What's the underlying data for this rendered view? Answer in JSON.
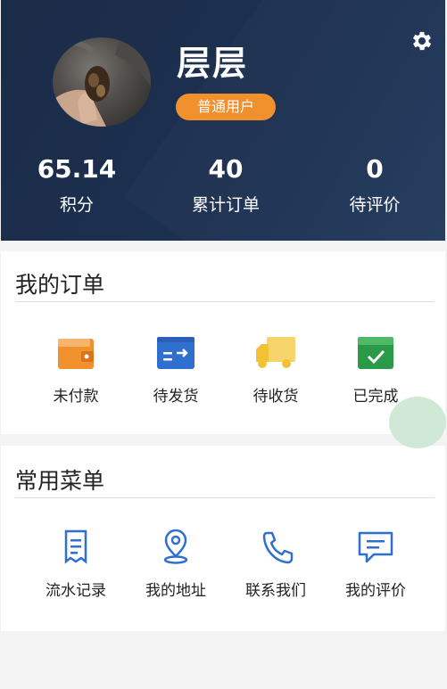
{
  "profile": {
    "name": "层层",
    "badge": "普通用户"
  },
  "stats": [
    {
      "value": "65.14",
      "label": "积分"
    },
    {
      "value": "40",
      "label": "累计订单"
    },
    {
      "value": "0",
      "label": "待评价"
    }
  ],
  "orders": {
    "title": "我的订单",
    "items": [
      {
        "label": "未付款",
        "icon": "wallet-icon",
        "color": "#f0912d"
      },
      {
        "label": "待发货",
        "icon": "box-send-icon",
        "color": "#2f6fd0"
      },
      {
        "label": "待收货",
        "icon": "truck-icon",
        "color": "#f3c233"
      },
      {
        "label": "已完成",
        "icon": "check-box-icon",
        "color": "#2a9a48"
      }
    ]
  },
  "menu": {
    "title": "常用菜单",
    "items": [
      {
        "label": "流水记录",
        "icon": "receipt-icon"
      },
      {
        "label": "我的地址",
        "icon": "location-icon"
      },
      {
        "label": "联系我们",
        "icon": "phone-icon"
      },
      {
        "label": "我的评价",
        "icon": "comment-icon"
      }
    ]
  },
  "colors": {
    "header": "#1c3050",
    "accent": "#f0912d",
    "menu_icon": "#2f6fd0",
    "float_button": "#cfe9d6"
  }
}
